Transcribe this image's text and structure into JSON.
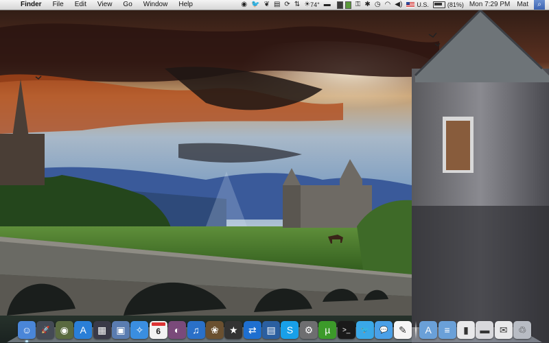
{
  "menubar": {
    "apple_glyph": "",
    "app_name": "Finder",
    "menus": [
      "File",
      "Edit",
      "View",
      "Go",
      "Window",
      "Help"
    ],
    "status": {
      "temperature": "74°",
      "battery": "(81%)",
      "input_source": "U.S.",
      "clock": "Mon 7:29 PM",
      "user": "Mat"
    }
  },
  "dock": {
    "apps": [
      {
        "icon": "finder-icon",
        "bg": "#4a86d8",
        "glyph": "☺"
      },
      {
        "icon": "launchpad-icon",
        "bg": "#444a55",
        "glyph": "🚀"
      },
      {
        "icon": "dashboard-icon",
        "bg": "#5a6a40",
        "glyph": "◉"
      },
      {
        "icon": "app-store-icon",
        "bg": "#2a7fd8",
        "glyph": "A"
      },
      {
        "icon": "mission-control-icon",
        "bg": "#3a3a48",
        "glyph": "▦"
      },
      {
        "icon": "preview-icon",
        "bg": "#5a7cb0",
        "glyph": "▣"
      },
      {
        "icon": "safari-icon",
        "bg": "#3a8ee0",
        "glyph": "✧"
      },
      {
        "icon": "calendar-icon",
        "bg": "#f2f2f2",
        "glyph": "6"
      },
      {
        "icon": "photo-booth-icon",
        "bg": "#7a4a7a",
        "glyph": "◐"
      },
      {
        "icon": "itunes-icon",
        "bg": "#2a70c8",
        "glyph": "♫"
      },
      {
        "icon": "iphoto-icon",
        "bg": "#6a5030",
        "glyph": "❀"
      },
      {
        "icon": "imovie-icon",
        "bg": "#333",
        "glyph": "★"
      },
      {
        "icon": "teamviewer-icon",
        "bg": "#1e6fd0",
        "glyph": "⇄"
      },
      {
        "icon": "virtualbox-icon",
        "bg": "#2b5fa0",
        "glyph": "▤"
      },
      {
        "icon": "skype-icon",
        "bg": "#18a0e8",
        "glyph": "S"
      },
      {
        "icon": "system-preferences-icon",
        "bg": "#6e6e70",
        "glyph": "⚙"
      },
      {
        "icon": "utorrent-icon",
        "bg": "#3c9a2a",
        "glyph": "µ"
      },
      {
        "icon": "terminal-icon",
        "bg": "#1a1a1a",
        "glyph": ">_"
      },
      {
        "icon": "twitter-icon",
        "bg": "#3aa8e8",
        "glyph": "🐦"
      },
      {
        "icon": "messages-icon",
        "bg": "#4aa0e8",
        "glyph": "💬"
      },
      {
        "icon": "textedit-icon",
        "bg": "#f5f5f5",
        "glyph": "✎"
      }
    ],
    "stacks": [
      {
        "icon": "applications-folder-icon",
        "bg": "#6aa0d8",
        "glyph": "A"
      },
      {
        "icon": "documents-folder-icon",
        "bg": "#6aa0d8",
        "glyph": "≡"
      },
      {
        "icon": "downloads-icon",
        "bg": "#e8e8ea",
        "glyph": "▮"
      },
      {
        "icon": "drive-icon",
        "bg": "#d8d8dc",
        "glyph": "▬"
      },
      {
        "icon": "mail-stack-icon",
        "bg": "#e8e8ea",
        "glyph": "✉"
      },
      {
        "icon": "trash-icon",
        "bg": "#b8bcc4",
        "glyph": "♲"
      }
    ]
  }
}
